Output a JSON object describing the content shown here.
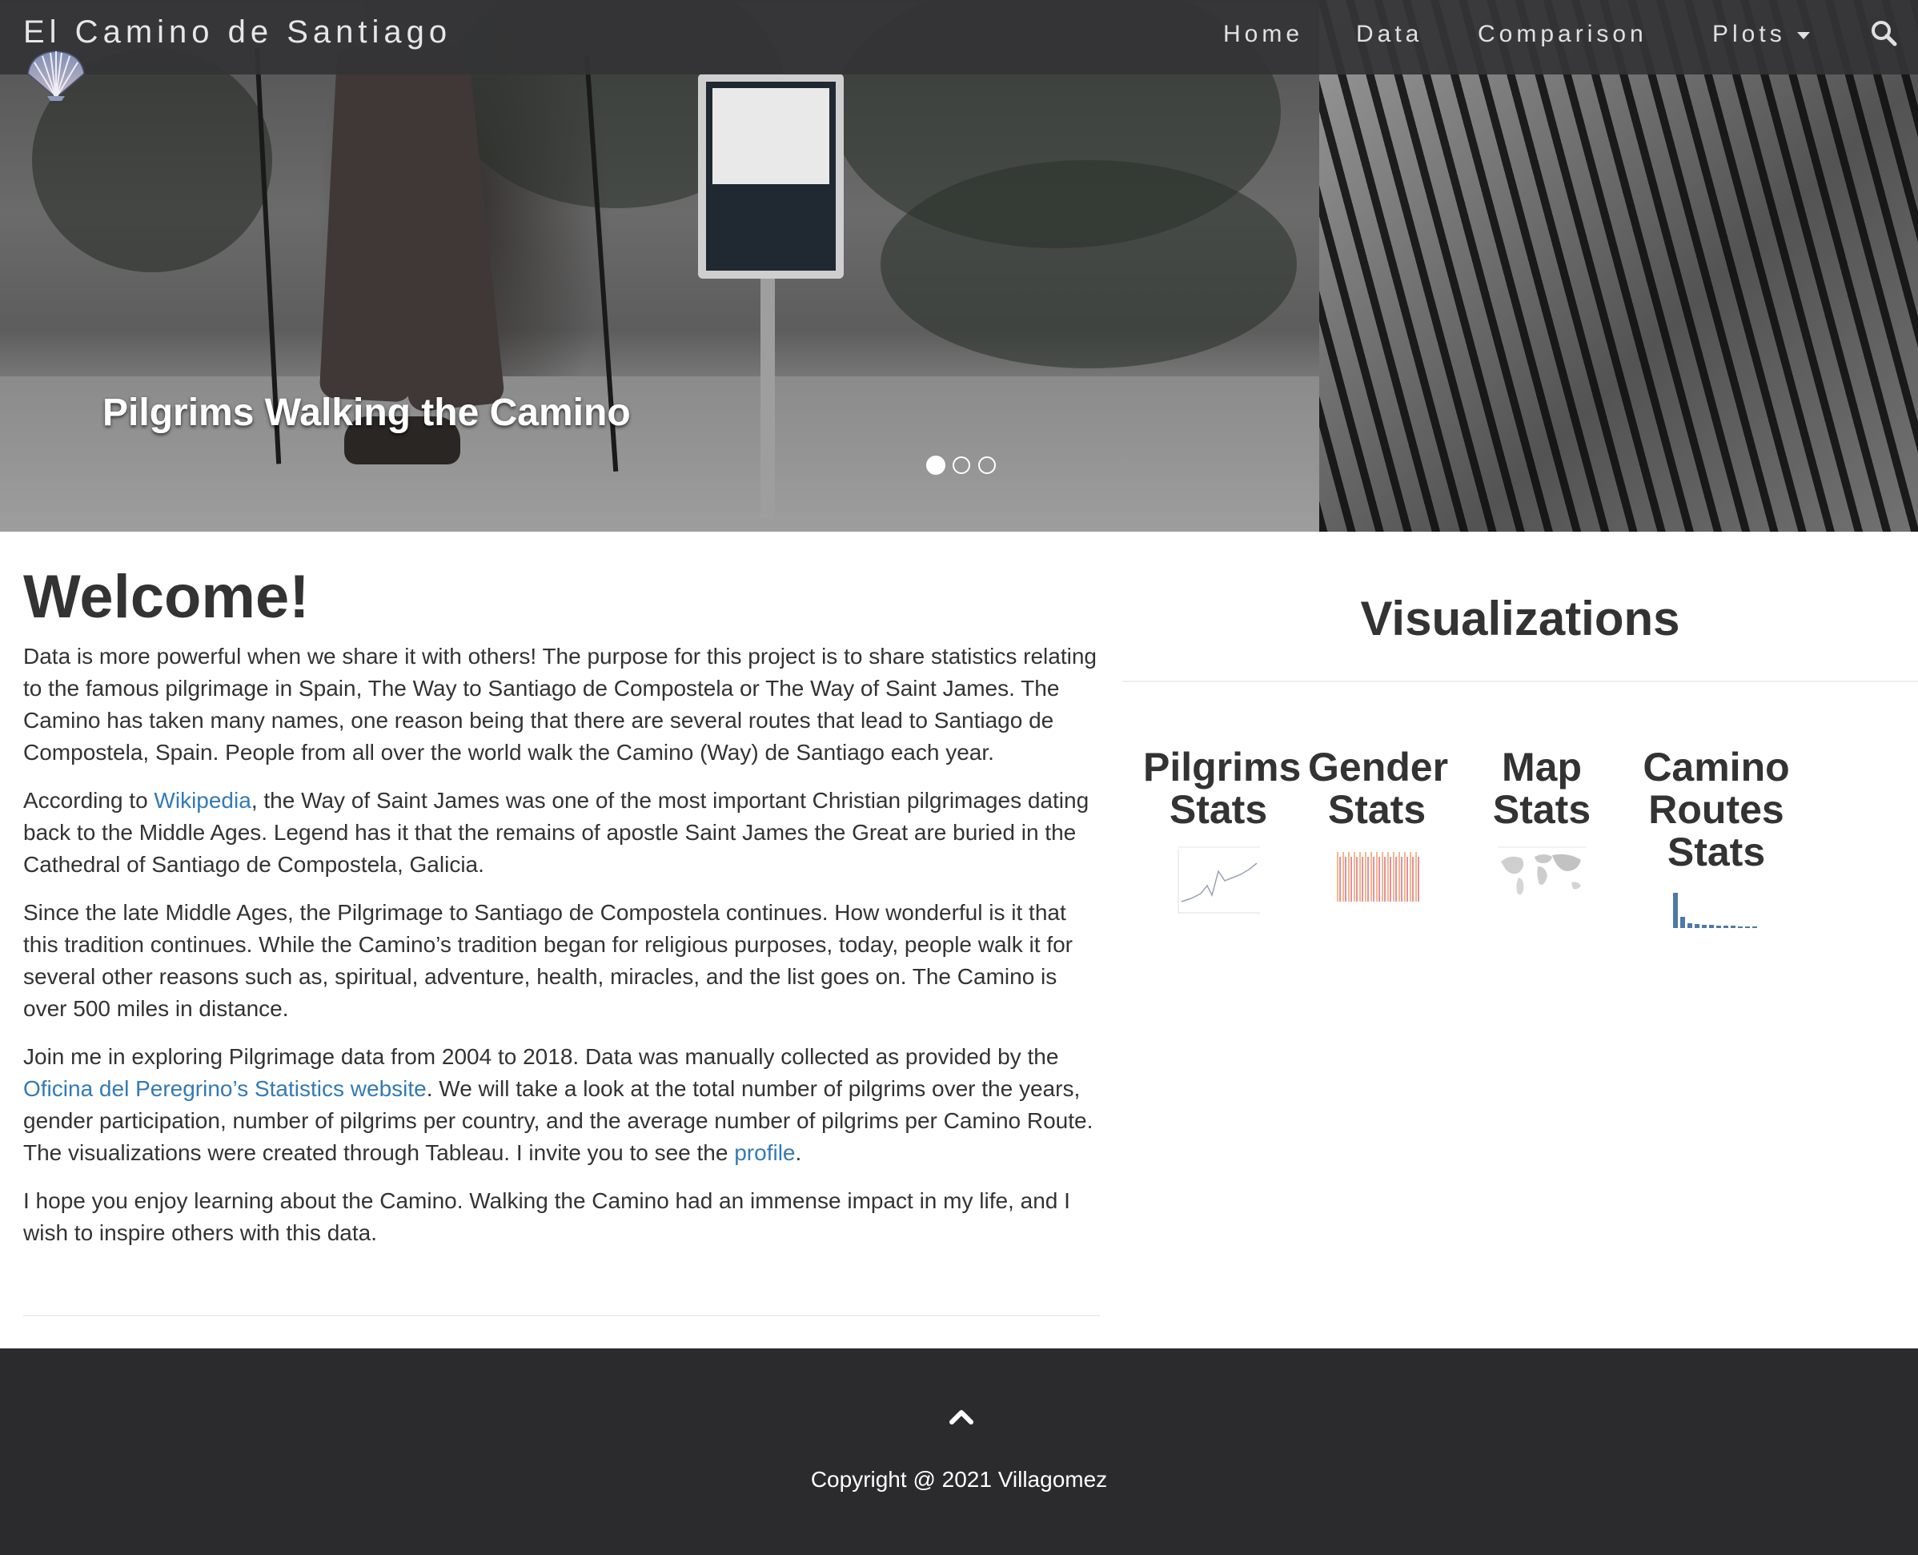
{
  "brand": {
    "title": "El Camino de Santiago",
    "logo_icon": "scallop-shell-icon"
  },
  "nav": {
    "items": [
      {
        "label": "Home"
      },
      {
        "label": "Data"
      },
      {
        "label": "Comparison"
      },
      {
        "label": "Plots"
      }
    ],
    "search_icon": "search-icon"
  },
  "carousel": {
    "caption": "Pilgrims Walking the Camino",
    "slide_count": 3,
    "active_index": 0
  },
  "welcome": {
    "title": "Welcome!",
    "p1": "Data is more powerful when we share it with others! The purpose for this project is to share statistics relating to the famous pilgrimage in Spain, The Way to Santiago de Compostela or The Way of Saint James. The Camino has taken many names, one reason being that there are several routes that lead to Santiago de Compostela, Spain. People from all over the world walk the Camino (Way) de Santiago each year.",
    "p2_before": "According to ",
    "p2_link": "Wikipedia",
    "p2_after": ", the Way of Saint James was one of the most important Christian pilgrimages dating back to the Middle Ages. Legend has it that the remains of apostle Saint James the Great are buried in the Cathedral of Santiago de Compostela, Galicia.",
    "p3": "Since the late Middle Ages, the Pilgrimage to Santiago de Compostela continues. How wonderful is it that this tradition continues. While the Camino’s tradition began for religious purposes, today, people walk it for several other reasons such as, spiritual, adventure, health, miracles, and the list goes on. The Camino is over 500 miles in distance.",
    "p4_before": "Join me in exploring Pilgrimage data from 2004 to 2018. Data was manually collected as provided by the ",
    "p4_link1": "Oficina del Peregrino’s Statistics website",
    "p4_middle": ". We will take a look at the total number of pilgrims over the years, gender participation, number of pilgrims per country, and the average number of pilgrims per Camino Route. The visualizations were created through Tableau. I invite you to see the ",
    "p4_link2": "profile",
    "p4_after": ".",
    "p5": "I hope you enjoy learning about the Camino. Walking the Camino had an immense impact in my life, and I wish to inspire others with this data."
  },
  "visualizations": {
    "title": "Visualizations",
    "cards": [
      {
        "line1": "Pilgrims",
        "line2": "Stats",
        "line3": ""
      },
      {
        "line1": "Gender",
        "line2": "Stats",
        "line3": ""
      },
      {
        "line1": "Map",
        "line2": "Stats",
        "line3": ""
      },
      {
        "line1": "Camino",
        "line2": "Routes",
        "line3": "Stats"
      }
    ]
  },
  "footer": {
    "back_to_top_icon": "chevron-up-icon",
    "copyright": "Copyright @ 2021 Villagomez"
  },
  "colors": {
    "navbar": "#343436",
    "footer": "#2b2b2d",
    "link": "#337ab7",
    "text": "#333333"
  }
}
